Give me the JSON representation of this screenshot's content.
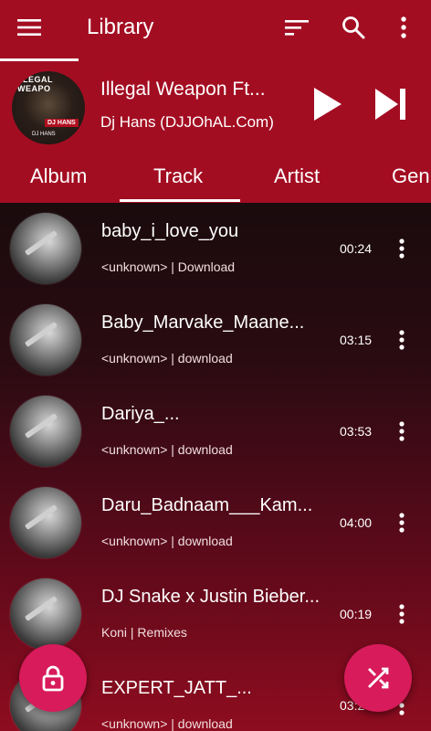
{
  "appbar": {
    "title": "Library"
  },
  "now_playing": {
    "title": "Illegal Weapon Ft...",
    "artist": "Dj Hans (DJJOhAL.Com)",
    "art_text_top": "LLEGAL WEAPO",
    "art_text_mid": "DJ HANS",
    "art_text_bottom": "DJ HANS"
  },
  "tabs": [
    {
      "label": "Album"
    },
    {
      "label": "Track"
    },
    {
      "label": "Artist"
    },
    {
      "label": "Genr"
    }
  ],
  "tracks": [
    {
      "title": "baby_i_love_you",
      "subtitle": "<unknown> | Download",
      "duration": "00:24"
    },
    {
      "title": "Baby_Marvake_Maane...",
      "subtitle": "<unknown> | download",
      "duration": "03:15"
    },
    {
      "title": "Dariya_...",
      "subtitle": "<unknown> | download",
      "duration": "03:53"
    },
    {
      "title": "Daru_Badnaam___Kam...",
      "subtitle": "<unknown> | download",
      "duration": "04:00"
    },
    {
      "title": "DJ Snake x Justin Bieber...",
      "subtitle": "Koni | Remixes",
      "duration": "00:19"
    },
    {
      "title": "EXPERT_JATT_...",
      "subtitle": "<unknown> | download",
      "duration": "03:24"
    }
  ],
  "colors": {
    "primary": "#a30d22",
    "fab": "#d81b5a"
  },
  "icons": {
    "menu": "menu-icon",
    "sort": "sort-icon",
    "search": "search-icon",
    "more": "more-vert-icon",
    "play": "play-icon",
    "next": "skip-next-icon",
    "lock": "lock-icon",
    "shuffle": "shuffle-icon"
  }
}
